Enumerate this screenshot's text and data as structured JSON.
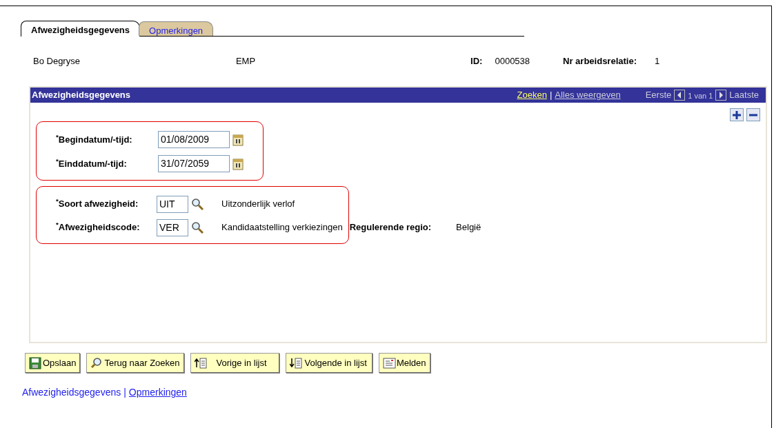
{
  "tabs": [
    {
      "label": "Afwezigheidsgegevens",
      "selected": true
    },
    {
      "label": "Opmerkingen",
      "selected": false
    }
  ],
  "employee": {
    "name": "Bo Degryse",
    "type": "EMP",
    "id_label": "ID:",
    "id": "0000538",
    "relation_label": "Nr arbeidsrelatie:",
    "relation": "1"
  },
  "panel": {
    "title": "Afwezigheidsgegevens",
    "search_link": "Zoeken",
    "separator": "|",
    "show_all": "Alles weergeven",
    "first": "Eerste",
    "count": "1 van 1",
    "last": "Laatste",
    "groups": [
      {
        "highlighted": true,
        "fields": [
          {
            "kind": "date",
            "label": "$^{*}$Begindatum/-tijd:",
            "value": "01/08/2009"
          },
          {
            "kind": "date",
            "label": "$^{*}$Einddatum/-tijd:",
            "value": "31/07/2059"
          }
        ]
      },
      {
        "highlighted": true,
        "fields": [
          {
            "kind": "lookup",
            "label": "$^{*}$Soort afwezigheid:",
            "value": "UIT",
            "description": "Uitzonderlijk verlof"
          },
          {
            "kind": "lookup",
            "label": "$^{*}$Afwezigheidscode:",
            "value": "VER",
            "description": "Kandidaatstelling verkiezingen",
            "extra_label": "Regulerende regio:",
            "extra_value": "België"
          }
        ]
      }
    ]
  },
  "buttons": [
    {
      "kind": "save",
      "label": "Opslaan"
    },
    {
      "kind": "search",
      "label": "Terug naar Zoeken"
    },
    {
      "kind": "prev",
      "label": "Vorige in lijst"
    },
    {
      "kind": "next",
      "label": "Volgende in lijst"
    },
    {
      "kind": "report",
      "label": "Melden"
    }
  ],
  "footer_separator": "|",
  "footer_links": [
    {
      "label": "Afwezigheidsgegevens",
      "selected": true
    },
    {
      "label": "Opmerkingen",
      "selected": false
    }
  ]
}
